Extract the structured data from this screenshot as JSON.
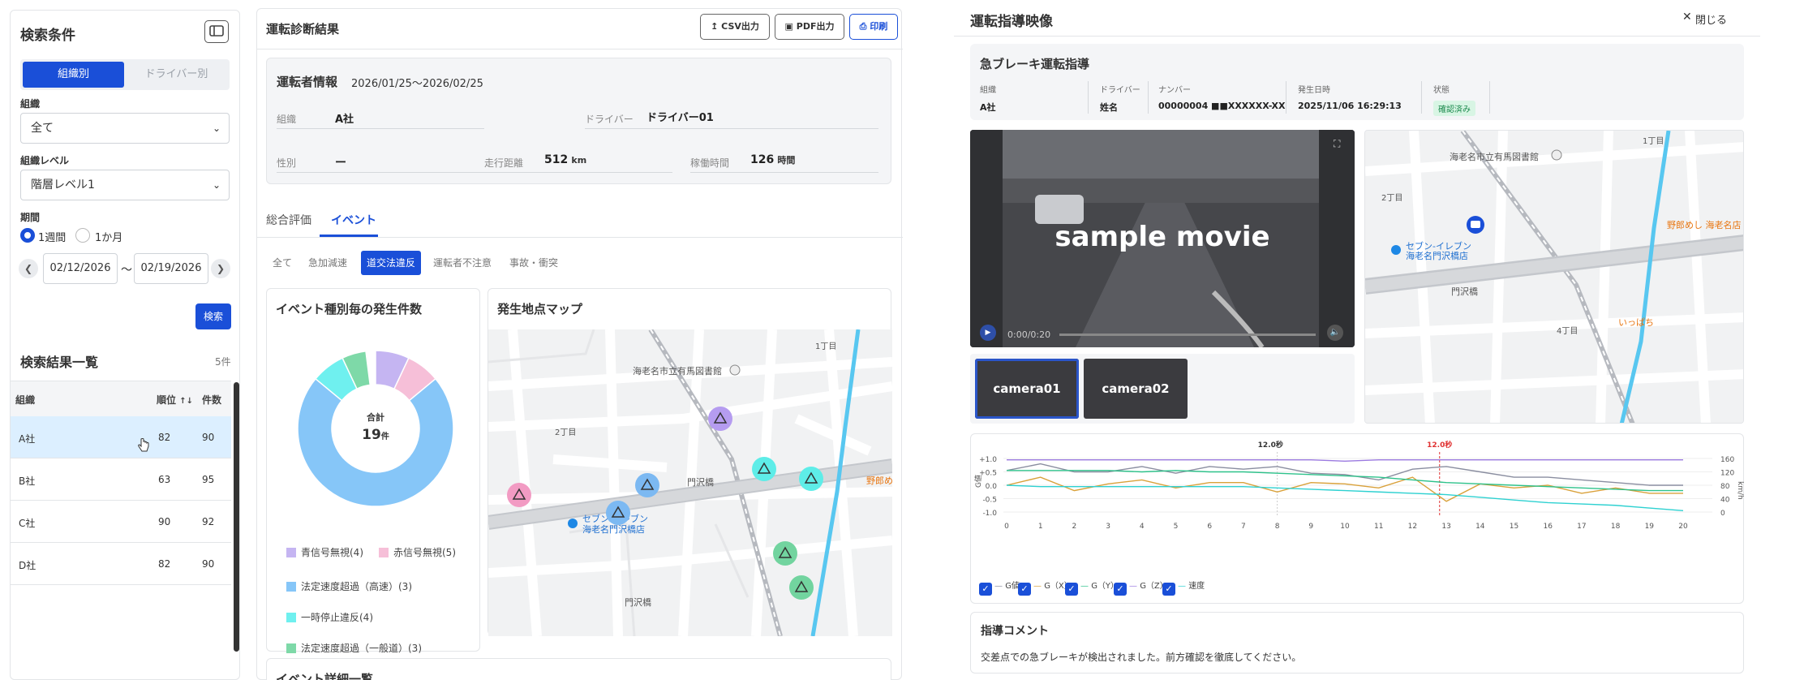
{
  "sidebar": {
    "title": "検索条件",
    "segments": [
      "組織別",
      "ドライバー別"
    ],
    "org_label": "組織",
    "org_value": "全て",
    "level_label": "組織レベル",
    "level_value": "階層レベル1",
    "period_label": "期間",
    "period_options": [
      "1週間",
      "1か月"
    ],
    "date_from": "02/12/2026",
    "date_sep": "〜",
    "date_to": "02/19/2026",
    "search_button": "検索",
    "results_title": "検索結果一覧",
    "results_count": "5件",
    "columns": {
      "org": "組織",
      "rank": "順位",
      "sort_icon": "↑↓",
      "count": "件数"
    },
    "rows": [
      {
        "org": "A社",
        "rank": "82",
        "count": "90"
      },
      {
        "org": "B社",
        "rank": "63",
        "count": "95"
      },
      {
        "org": "C社",
        "rank": "90",
        "count": "92"
      },
      {
        "org": "D社",
        "rank": "82",
        "count": "90"
      }
    ]
  },
  "main": {
    "title": "運転診断結果",
    "buttons": {
      "csv": "CSV出力",
      "pdf": "PDF出力",
      "print": "印刷"
    },
    "driver_info": {
      "title": "運転者情報",
      "period": "2026/01/25〜2026/02/25",
      "org_k": "組織",
      "org_v": "A社",
      "driver_k": "ドライバー",
      "driver_v": "ドライバー01",
      "gender_k": "性別",
      "gender_v": "ー",
      "distance_k": "走行距離",
      "distance_v": "512",
      "distance_u": "km",
      "hours_k": "稼働時間",
      "hours_v": "126",
      "hours_u": "時間"
    },
    "tabs": [
      "総合評価",
      "イベント"
    ],
    "chips": [
      "全て",
      "急加減速",
      "道交法違反",
      "運転者不注意",
      "事故・衝突"
    ],
    "donut_card_title": "イベント種別毎の発生件数",
    "donut_center_label": "合計",
    "donut_center_value": "19",
    "donut_center_unit": "件",
    "map_card_title": "発生地点マップ",
    "detail_card_title": "イベント詳細一覧",
    "map_labels": {
      "library": "海老名市立有馬図書館",
      "seven1": "セブン-イレブン",
      "seven2": "海老名門沢橋店",
      "monzawa": "門沢橋",
      "monzawa_st": "門沢橋",
      "chome1": "1丁目",
      "chome2": "2丁目",
      "noribeme": "野郎めし"
    }
  },
  "chart_data": {
    "type": "pie",
    "title": "イベント種別毎の発生件数",
    "categories": [
      "青信号無視(4)",
      "赤信号無視(5)",
      "法定速度超過（高速）(3)",
      "一時停止違反(4)",
      "法定速度超過（一般道）(3)"
    ],
    "values": [
      4,
      5,
      3,
      4,
      3
    ],
    "colors": [
      "#c5b5f2",
      "#f6bfd8",
      "#86c6f8",
      "#6ff0ef",
      "#7ed9a8"
    ],
    "display_fractions": [
      0.07,
      0.07,
      0.72,
      0.07,
      0.05
    ]
  },
  "video_panel": {
    "title": "運転指導映像",
    "close": "閉じる",
    "subtitle": "急ブレーキ運転指導",
    "cols": [
      {
        "k": "組織",
        "v": "A社"
      },
      {
        "k": "ドライバー",
        "v": "姓名"
      },
      {
        "k": "ナンバー",
        "v": "00000004 ■■XXXXXX-XX"
      },
      {
        "k": "発生日時",
        "v": "2025/11/06 16:29:13"
      },
      {
        "k": "状態",
        "v": "確認済み"
      }
    ],
    "movie_text": "sample movie",
    "movie_time": "0:00/0:20",
    "cameras": [
      "camera01",
      "camera02"
    ],
    "gchart": {
      "marker1": "12.0秒",
      "marker2": "12.0秒",
      "y_left_label": "G値",
      "y_right_label": "km/h",
      "y_left_ticks": [
        "+1.0",
        "+0.5",
        "0.0",
        "-0.5",
        "-1.0"
      ],
      "y_right_ticks": [
        "160",
        "120",
        "80",
        "40",
        "0"
      ],
      "x_ticks": [
        "0",
        "1",
        "2",
        "3",
        "4",
        "5",
        "6",
        "7",
        "8",
        "9",
        "10",
        "11",
        "12",
        "13",
        "14",
        "15",
        "16",
        "17",
        "18",
        "19",
        "20"
      ],
      "legend": [
        "G値",
        "G（X）",
        "G（Y）",
        "G（Z）",
        "速度"
      ],
      "colors": {
        "g": "#8a8ea0",
        "gx": "#d9a13a",
        "gy": "#2ec28b",
        "gz": "#9b7ae0",
        "speed": "#2ed1d1",
        "marker": "#e03131"
      }
    },
    "comment_title": "指導コメント",
    "comment_text": "交差点での急ブレーキが検出されました。前方確認を徹底してください。",
    "map_labels": {
      "library": "海老名市立有馬図書館",
      "seven1": "セブン-イレブン",
      "seven2": "海老名門沢橋店",
      "monzawa": "門沢橋",
      "chome1": "1丁目",
      "chome2": "2丁目",
      "chome4": "4丁目",
      "noribeme": "野郎めし 海老名店",
      "ippachi": "いっぱち"
    }
  }
}
